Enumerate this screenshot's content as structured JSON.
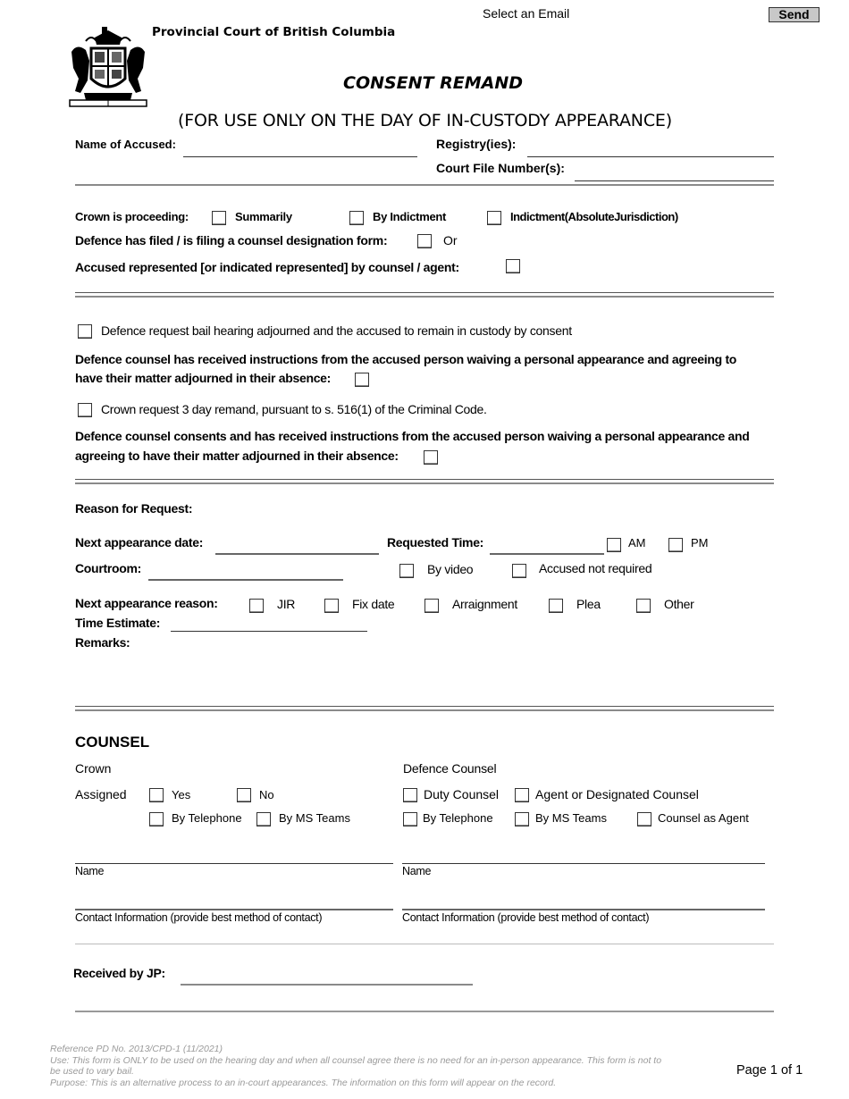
{
  "toolbar": {
    "email_label": "Select an Email",
    "send_label": "Send"
  },
  "header": {
    "court_name": "Provincial Court of British Columbia",
    "title": "CONSENT REMAND",
    "subtitle": "(FOR USE ONLY ON THE DAY OF IN-CUSTODY APPEARANCE)",
    "logo_icon": "royal-coat-of-arms"
  },
  "identification": {
    "name_of_accused_label": "Name of Accused:",
    "name_of_accused_value": "",
    "registry_label": "Registry(ies):",
    "registry_value": "",
    "court_file_label": "Court File Number(s):",
    "court_file_value": ""
  },
  "proceeding": {
    "crown_label": "Crown is proceeding:",
    "options": [
      {
        "label": "Summarily",
        "checked": false
      },
      {
        "label": "By Indictment",
        "checked": false
      },
      {
        "label": "Indictment(AbsoluteJurisdiction)",
        "checked": false
      }
    ],
    "designation_label": "Defence has filed / is filing a counsel  designation form:",
    "designation_checked": false,
    "or_label": "Or",
    "represented_label": "Accused represented [or indicated represented] by counsel /  agent:",
    "represented_checked": false
  },
  "requests": {
    "bail_adjourned_label": "Defence request bail hearing adjourned and the accused to remain in custody by consent",
    "bail_adjourned_checked": false,
    "waiver1_line1": "Defence counsel has received instructions from the accused person waiving a personal appearance and agreeing to",
    "waiver1_line2": "have their matter adjourned in their absence:",
    "waiver1_checked": false,
    "crown_remand_label": "Crown request 3 day remand, pursuant to  s. 516(1) of the Criminal Code.",
    "crown_remand_checked": false,
    "waiver2_line1": "Defence counsel consents and has received instructions from the accused person waiving a personal appearance and",
    "waiver2_line2": "agreeing to have their matter adjourned in their absence:",
    "waiver2_checked": false
  },
  "appearance": {
    "reason_label": "Reason for Request:",
    "next_date_label": "Next appearance date:",
    "next_date_value": "",
    "requested_time_label": "Requested Time:",
    "requested_time_value": "",
    "am_label": "AM",
    "pm_label": "PM",
    "courtroom_label": "Courtroom:",
    "courtroom_value": "",
    "by_video_label": "By video",
    "accused_not_required_label": "Accused not required",
    "next_reason_label": "Next appearance reason:",
    "reasons": [
      "JIR",
      "Fix date",
      "Arraignment",
      "Plea",
      "Other"
    ],
    "time_estimate_label": "Time Estimate:",
    "time_estimate_value": "",
    "remarks_label": "Remarks:",
    "remarks_value": ""
  },
  "counsel": {
    "heading": "COUNSEL",
    "crown": {
      "heading": "Crown",
      "assigned_label": "Assigned",
      "yes_label": "Yes",
      "no_label": "No",
      "telephone_label": "By Telephone",
      "teams_label": "By MS Teams",
      "name_label": "Name",
      "contact_label": "Contact Information (provide best method of contact)"
    },
    "defence": {
      "heading": "Defence Counsel",
      "duty_label": "Duty Counsel",
      "agent_label": "Agent or Designated Counsel",
      "telephone_label": "By Telephone",
      "teams_label": "By MS Teams",
      "counsel_as_agent_label": "Counsel as Agent",
      "name_label": "Name",
      "contact_label": "Contact Information (provide best method of contact)"
    }
  },
  "received": {
    "label": "Received by JP:",
    "value": ""
  },
  "footer": {
    "reference": "Reference PD No. 2013/CPD-1 (11/2021)",
    "use_line1": "Use: This form is ONLY to be used on the hearing day and when all counsel agree there is no need for an in-person appearance.  This form is not to",
    "use_line2": "be used to vary bail.",
    "purpose": "Purpose: This is an alternative process to an in-court appearances. The information on this form will appear on the record.",
    "page": "Page 1 of 1"
  }
}
